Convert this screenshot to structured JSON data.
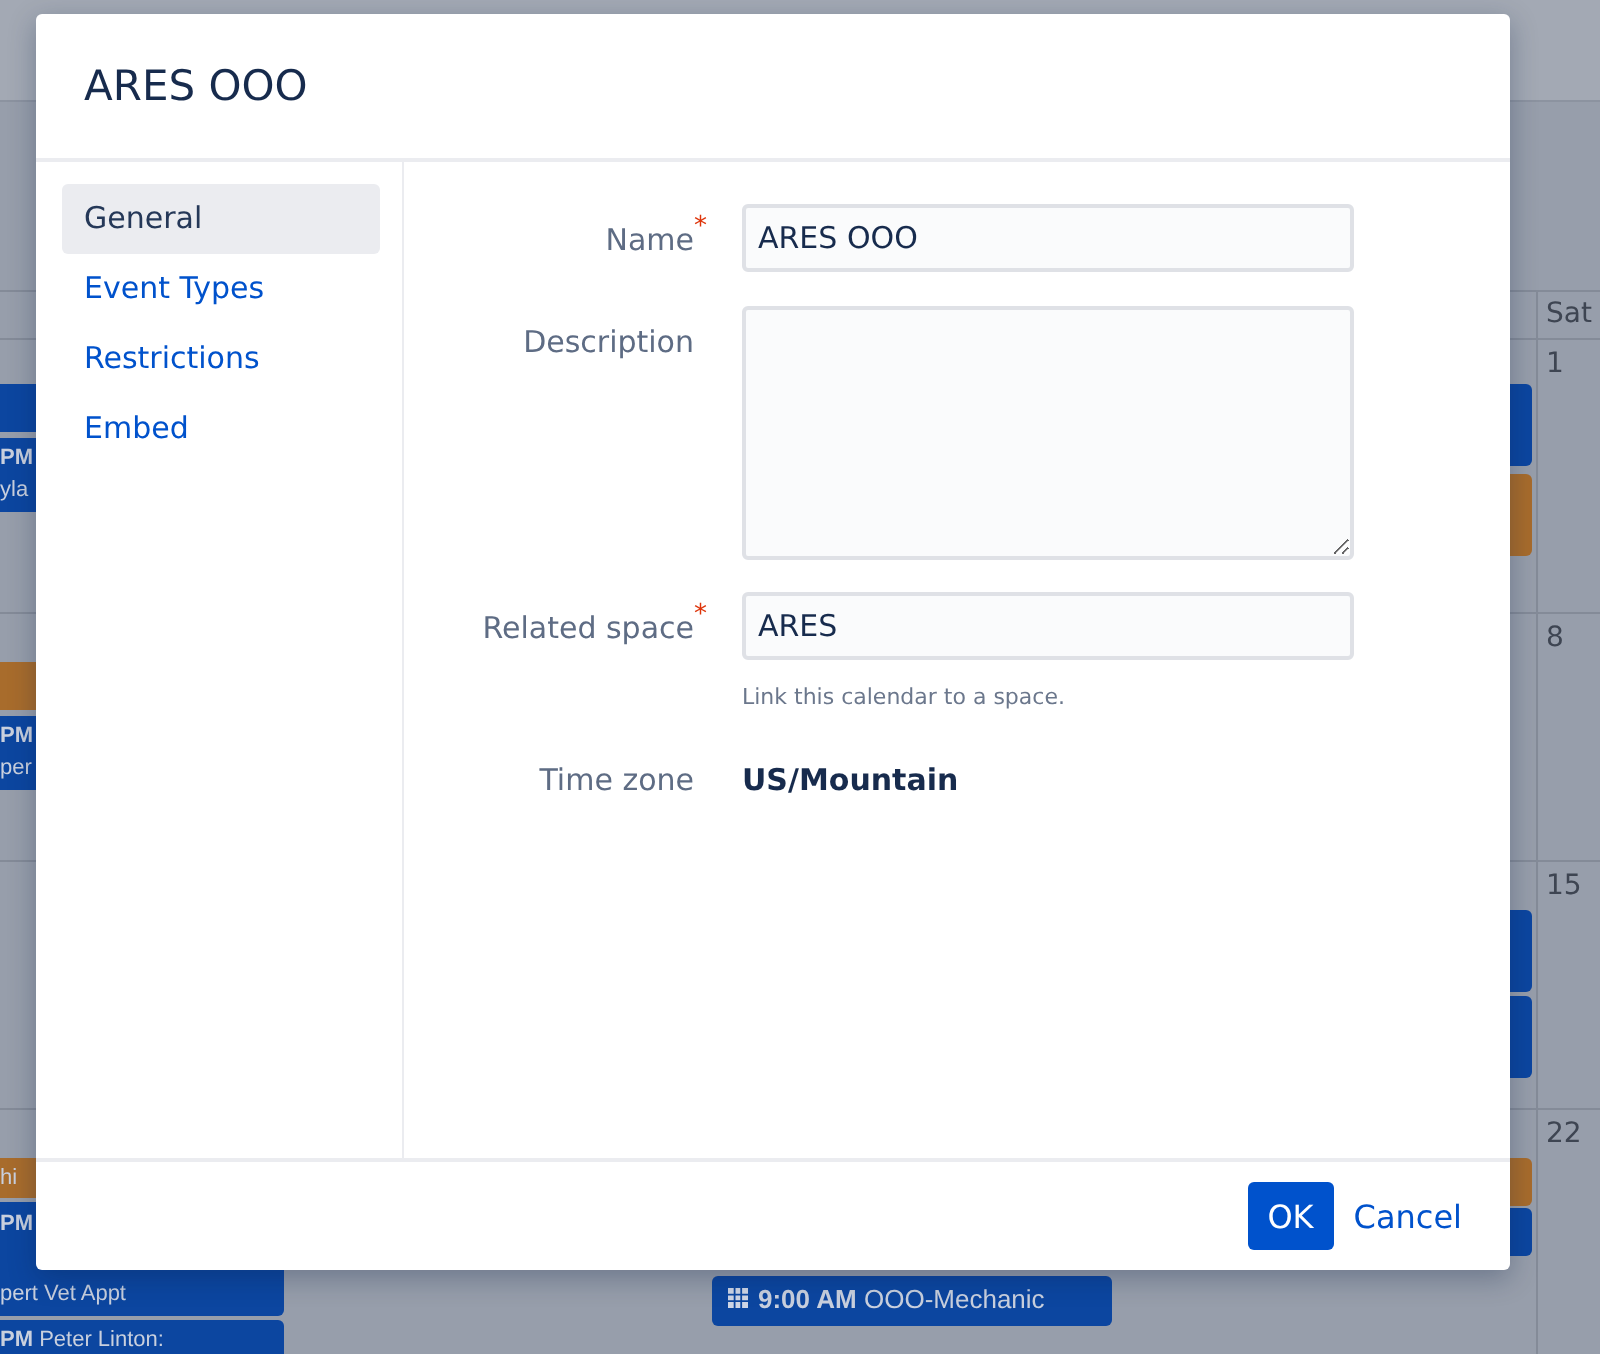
{
  "calendar": {
    "header": [
      {
        "label": "Sat"
      }
    ],
    "weeks": [
      {
        "date": "1",
        "columns": [
          [
            {
              "kind": "bar",
              "color": "#0c46a0"
            },
            {
              "kind": "stacked",
              "color": "#0c46a0",
              "time": "PM",
              "title": "yla"
            }
          ],
          [],
          [],
          [
            {
              "kind": "tall",
              "color": "#0c46a0"
            },
            {
              "kind": "tall",
              "color": "#a86c2c"
            }
          ]
        ]
      },
      {
        "date": "8",
        "columns": [
          [
            {
              "kind": "bar",
              "color": "#a86c2c"
            },
            {
              "kind": "stacked",
              "color": "#0c46a0",
              "time": "PM",
              "title": "per"
            }
          ],
          [],
          [],
          []
        ]
      },
      {
        "date": "15",
        "columns": [
          [],
          [],
          [],
          [
            {
              "kind": "tall",
              "color": "#0c46a0"
            },
            {
              "kind": "tall",
              "color": "#0c46a0"
            }
          ]
        ]
      },
      {
        "date": "22",
        "columns": [
          [
            {
              "kind": "inline",
              "color": "#a86c2c",
              "title": "hi"
            },
            {
              "kind": "stacked",
              "color": "#0c46a0",
              "time": "PM",
              "title": "pert Vet Appt"
            },
            {
              "kind": "inline",
              "color": "#0c46a0",
              "time": "PM",
              "title": "Peter Linton:"
            }
          ],
          [],
          [
            {
              "kind": "icon",
              "color": "#0c46a0",
              "time": "9:00 AM",
              "title": "OOO-Mechanic"
            }
          ],
          [
            {
              "kind": "bar",
              "color": "#a86c2c"
            },
            {
              "kind": "bar",
              "color": "#0c46a0"
            }
          ]
        ]
      }
    ]
  },
  "dialog": {
    "title": "ARES OOO",
    "nav": [
      {
        "label": "General",
        "selected": true
      },
      {
        "label": "Event Types",
        "selected": false
      },
      {
        "label": "Restrictions",
        "selected": false
      },
      {
        "label": "Embed",
        "selected": false
      }
    ],
    "fields": [
      {
        "kind": "input",
        "label": "Name",
        "required_mark": "*",
        "value": "ARES OOO"
      },
      {
        "kind": "textarea",
        "label": "Description"
      },
      {
        "kind": "input",
        "label": "Related space",
        "required_mark": "*",
        "value": "ARES",
        "help": "Link this calendar to a space."
      },
      {
        "kind": "text",
        "label": "Time zone",
        "value": "US/Mountain"
      }
    ],
    "buttons": [
      {
        "label": "OK",
        "kind": "primary"
      },
      {
        "label": "Cancel",
        "kind": "link"
      }
    ]
  }
}
